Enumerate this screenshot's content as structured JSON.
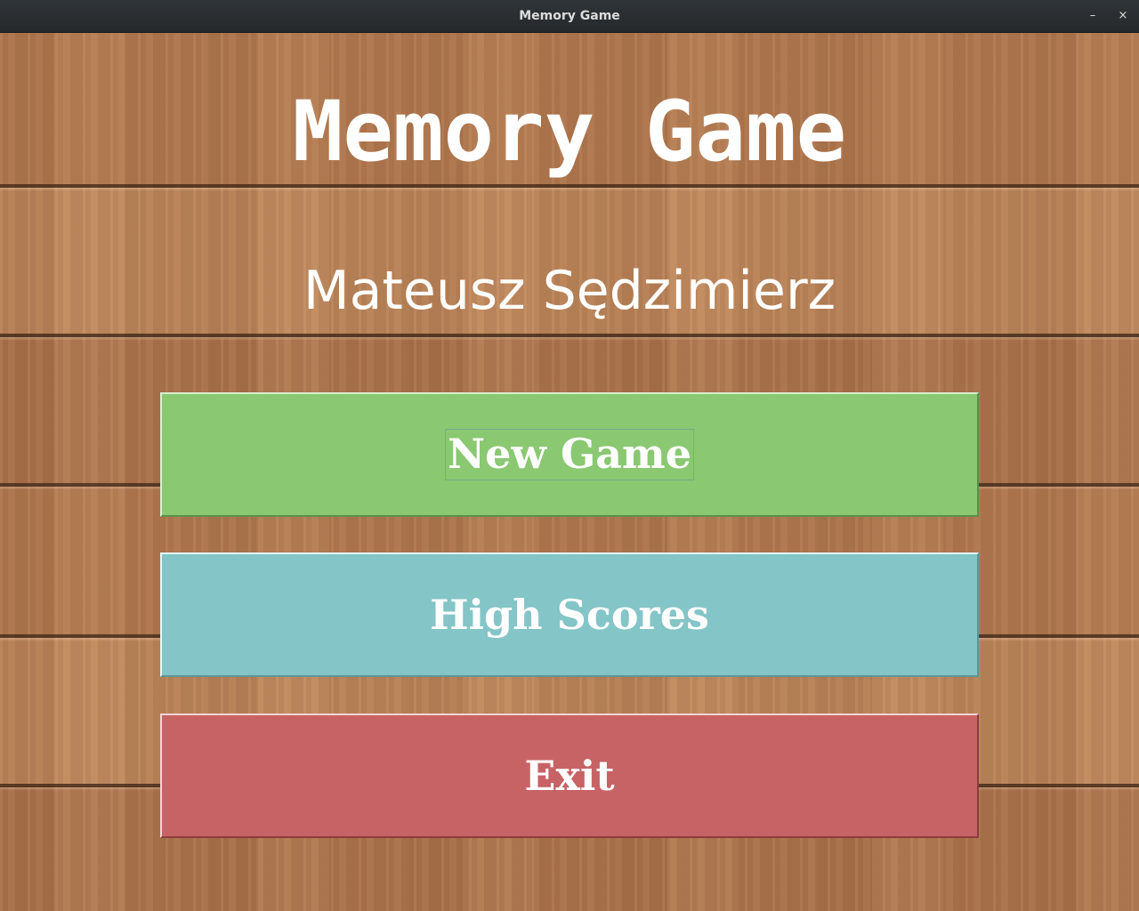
{
  "window": {
    "title": "Memory Game",
    "minimize_glyph": "–",
    "close_glyph": "×"
  },
  "menu": {
    "title": "Memory Game",
    "author": "Mateusz Sędzimierz",
    "buttons": {
      "new_game": "New Game",
      "high_scores": "High Scores",
      "exit": "Exit"
    }
  },
  "colors": {
    "new_game": "#8ac872",
    "high_scores": "#84c5c7",
    "exit": "#c86365",
    "text": "#ffffff",
    "background": "#b98055"
  },
  "icons": {
    "minimize": "minimize-icon",
    "close": "close-icon"
  }
}
